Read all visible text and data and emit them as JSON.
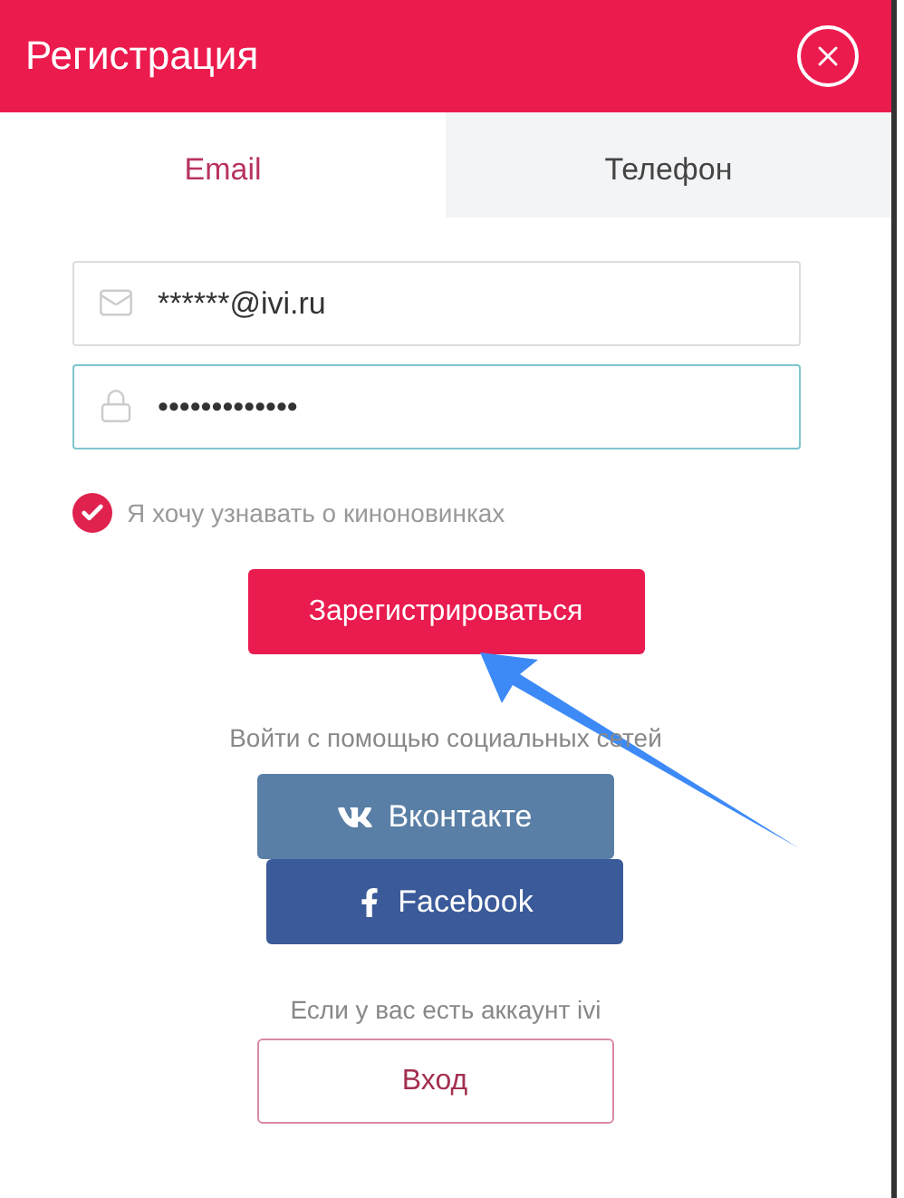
{
  "dialog": {
    "title": "Регистрация"
  },
  "tabs": [
    {
      "label": "Email",
      "selected": true
    },
    {
      "label": "Телефон",
      "selected": false
    }
  ],
  "fields": [
    {
      "kind": "email",
      "value": "******@ivi.ru",
      "focused": false
    },
    {
      "kind": "password",
      "value": "•••••••••••••",
      "focused": true
    }
  ],
  "newsletter": {
    "label": "Я хочу узнавать о киноновинках",
    "checked": true
  },
  "register_button": "Зарегистрироваться",
  "social_caption": "Войти с помощью социальных сетей",
  "social_buttons": [
    {
      "kind": "vk",
      "label": "Вконтакте"
    },
    {
      "kind": "facebook",
      "label": "Facebook"
    }
  ],
  "login_caption": "Если у вас есть аккаунт ivi",
  "login_button": "Вход"
}
